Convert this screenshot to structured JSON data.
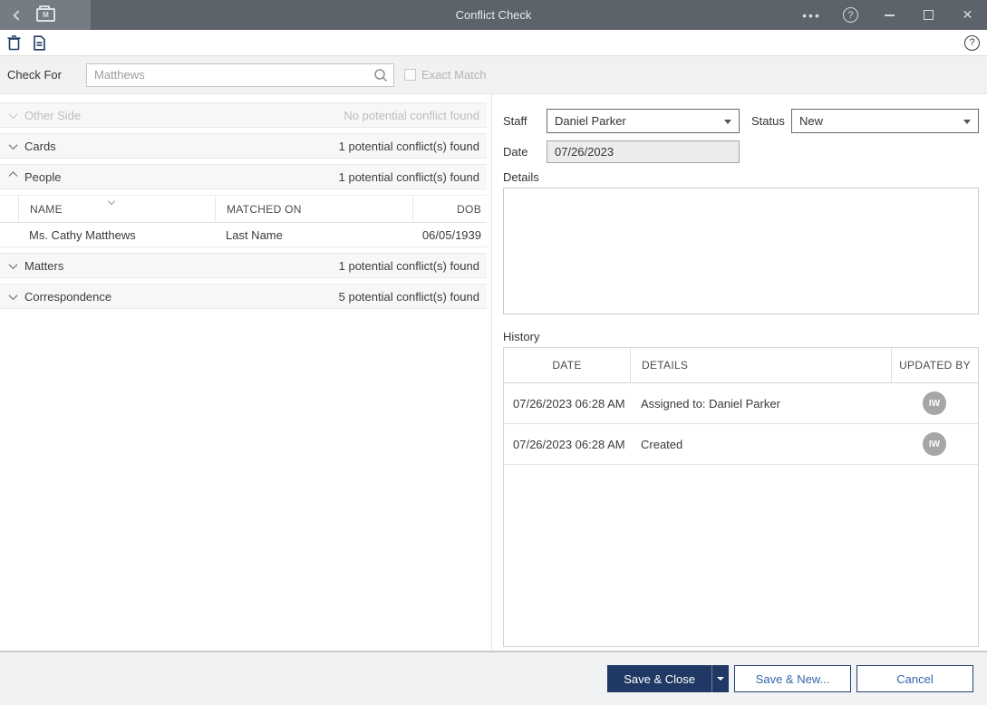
{
  "window": {
    "title": "Conflict Check"
  },
  "titlebar": {
    "icons": {
      "back": "‹",
      "folder_letter": "M",
      "ellipsis": "•••",
      "help": "?",
      "close": "✕"
    }
  },
  "toolbar": {
    "icons": {
      "delete": "trash-icon",
      "new_document": "document-icon"
    },
    "help": "?"
  },
  "search": {
    "label": "Check For",
    "value": "Matthews",
    "exact_match_label": "Exact Match",
    "exact_match_checked": false
  },
  "results": {
    "sections": [
      {
        "label": "Other Side",
        "status": "No potential conflict found",
        "expanded": false,
        "disabled": true
      },
      {
        "label": "Cards",
        "status": "1 potential conflict(s) found",
        "expanded": false,
        "disabled": false
      },
      {
        "label": "People",
        "status": "1 potential conflict(s) found",
        "expanded": true,
        "disabled": false
      },
      {
        "label": "Matters",
        "status": "1 potential conflict(s) found",
        "expanded": false,
        "disabled": false
      },
      {
        "label": "Correspondence",
        "status": "5 potential conflict(s) found",
        "expanded": false,
        "disabled": false
      }
    ],
    "people_table": {
      "columns": [
        "NAME",
        "MATCHED ON",
        "DOB"
      ],
      "sorted_column": "NAME",
      "rows": [
        {
          "name": "Ms. Cathy Matthews",
          "matched_on": "Last Name",
          "dob": "06/05/1939"
        }
      ]
    }
  },
  "form": {
    "staff_label": "Staff",
    "staff_value": "Daniel Parker",
    "status_label": "Status",
    "status_value": "New",
    "date_label": "Date",
    "date_value": "07/26/2023",
    "details_label": "Details",
    "details_value": ""
  },
  "history": {
    "label": "History",
    "columns": [
      "DATE",
      "DETAILS",
      "UPDATED BY"
    ],
    "rows": [
      {
        "date": "07/26/2023 06:28 AM",
        "details": "Assigned to: Daniel Parker",
        "updated_by": "IW"
      },
      {
        "date": "07/26/2023 06:28 AM",
        "details": "Created",
        "updated_by": "IW"
      }
    ]
  },
  "footer": {
    "save_close_label": "Save & Close",
    "save_new_label": "Save & New...",
    "cancel_label": "Cancel"
  },
  "colors": {
    "accent_navy": "#1f3864",
    "button_text_blue": "#3465a8",
    "titlebar": "#5d636a",
    "titlebar_left": "#757c84",
    "footer_bg": "#f1f2f3",
    "section_row_bg": "#f7f7f7",
    "disabled_text": "#bdbdbd",
    "avatar_bg": "#a6a6a6",
    "date_field_bg": "#ececec"
  }
}
